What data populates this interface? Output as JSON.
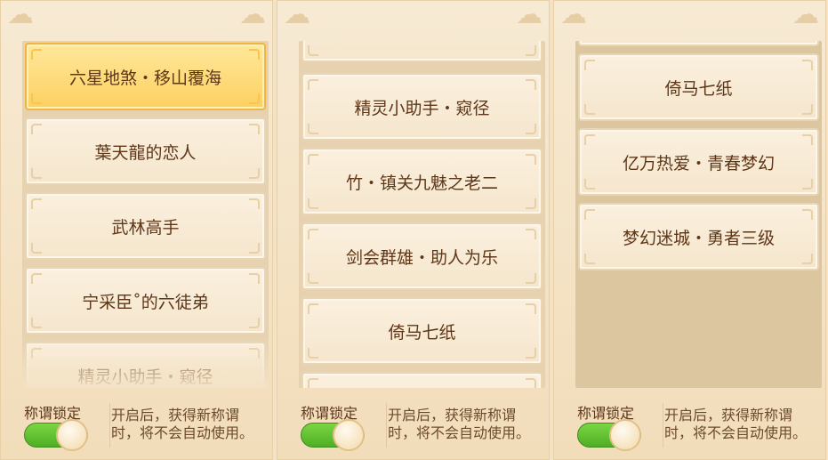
{
  "panels": [
    {
      "items": [
        {
          "label": "六星地煞・移山覆海"
        },
        {
          "label": "葉天龍的恋人"
        },
        {
          "label": "武林高手"
        },
        {
          "label": "宁采臣˚的六徒弟"
        },
        {
          "label": "精灵小助手・窥径"
        }
      ],
      "footer": {
        "lock_label": "称谓锁定",
        "desc_line1": "开启后，获得新称谓",
        "desc_line2": "时，将不会自动使用。"
      }
    },
    {
      "items": [
        {
          "label": "精灵小助手・窥径"
        },
        {
          "label": "竹・镇关九魅之老二"
        },
        {
          "label": "剑会群雄・助人为乐"
        },
        {
          "label": "倚马七纸"
        }
      ],
      "footer": {
        "lock_label": "称谓锁定",
        "desc_line1": "开启后，获得新称谓",
        "desc_line2": "时，将不会自动使用。"
      }
    },
    {
      "items": [
        {
          "label": "倚马七纸"
        },
        {
          "label": "亿万热爱・青春梦幻"
        },
        {
          "label": "梦幻迷城・勇者三级"
        }
      ],
      "footer": {
        "lock_label": "称谓锁定",
        "desc_line1": "开启后，获得新称谓",
        "desc_line2": "时，将不会自动使用。"
      }
    }
  ],
  "toggle_state": "on",
  "colors": {
    "accent_selected": "#fcd061",
    "toggle_on": "#4fae25",
    "text": "#5e3618"
  }
}
